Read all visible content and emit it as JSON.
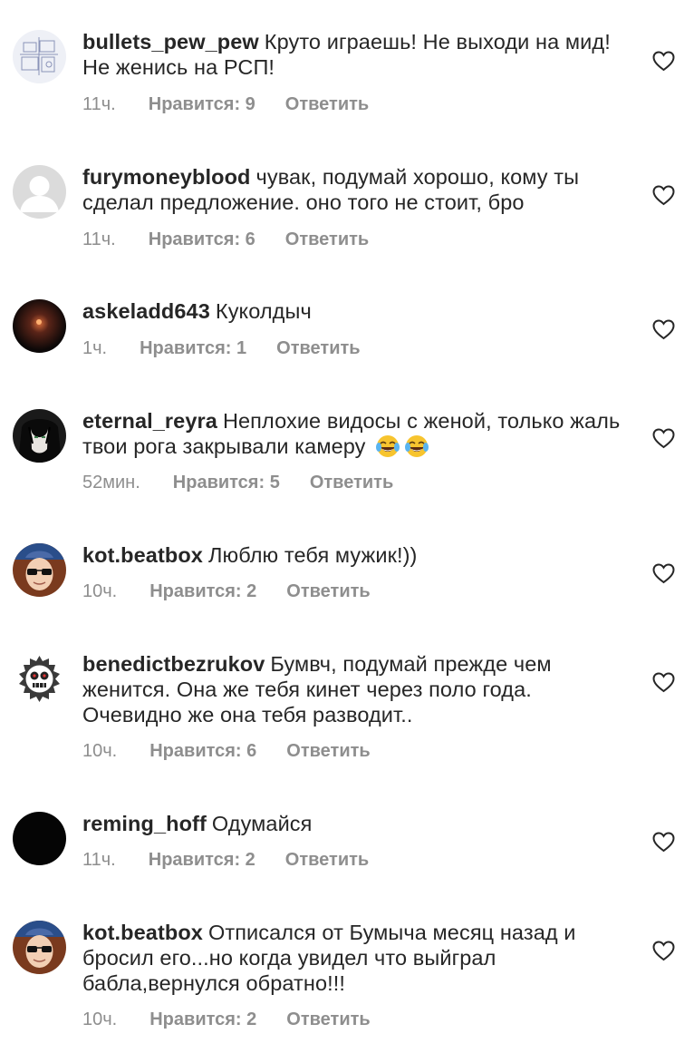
{
  "comments": [
    {
      "username": "bullets_pew_pew",
      "text": "Круто играешь! Не выходи на мид! Не женись на РСП!",
      "time": "11ч.",
      "likes": "Нравится: 9",
      "reply": "Ответить",
      "avatar": "sketch-avatar"
    },
    {
      "username": "furymoneyblood",
      "text": "чувак, подумай хорошо, кому ты сделал предложение. оно того не стоит, бро",
      "time": "11ч.",
      "likes": "Нравится: 6",
      "reply": "Ответить",
      "avatar": "default-avatar"
    },
    {
      "username": "askeladd643",
      "text": "Куколдыч",
      "time": "1ч.",
      "likes": "Нравится: 1",
      "reply": "Ответить",
      "avatar": "dark-photo-avatar"
    },
    {
      "username": "eternal_reyra",
      "text": "Неплохие видосы с женой, только жаль твои рога закрывали камеру",
      "emoji": [
        "laughing-crying-emoji",
        "laughing-crying-emoji"
      ],
      "time": "52мин.",
      "likes": "Нравится: 5",
      "reply": "Ответить",
      "avatar": "anime-avatar"
    },
    {
      "username": "kot.beatbox",
      "text": "Люблю тебя мужик!))",
      "time": "10ч.",
      "likes": "Нравится: 2",
      "reply": "Ответить",
      "avatar": "sunglasses-avatar"
    },
    {
      "username": "benedictbezrukov",
      "text": "Бумвч, подумай прежде чем женится. Она же тебя кинет через поло года. Очевидно же она тебя разводит..",
      "time": "10ч.",
      "likes": "Нравится: 6",
      "reply": "Ответить",
      "avatar": "skull-emblem-avatar"
    },
    {
      "username": "reming_hoff",
      "text": "Одумайся",
      "time": "11ч.",
      "likes": "Нравится: 2",
      "reply": "Ответить",
      "avatar": "black-avatar"
    },
    {
      "username": "kot.beatbox",
      "text": "Отписался от Бумыча месяц назад и бросил его...но когда увидел что выйграл бабла,вернулся обратно!!!",
      "time": "10ч.",
      "likes": "Нравится: 2",
      "reply": "Ответить",
      "avatar": "sunglasses-avatar"
    }
  ],
  "colors": {
    "text": "#262626",
    "meta": "#8e8e8e",
    "background": "#ffffff"
  },
  "icons": {
    "like": "heart-outline-icon"
  }
}
